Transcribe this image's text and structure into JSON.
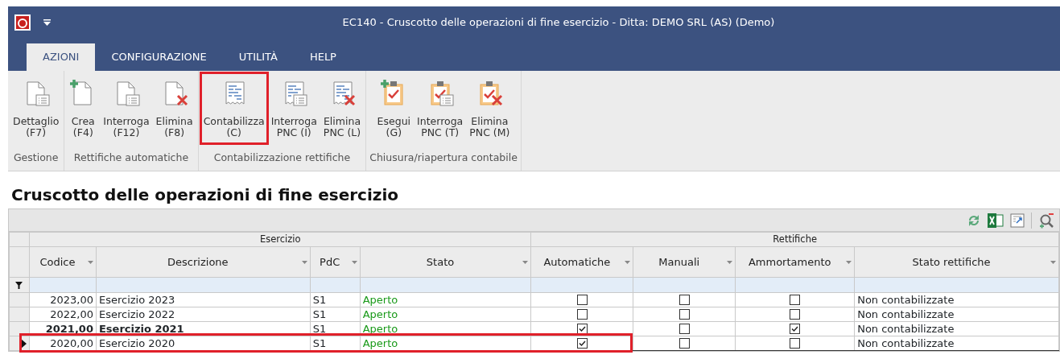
{
  "window": {
    "title": "EC140 - Cruscotto delle operazioni di fine esercizio - Ditta: DEMO SRL (AS)  (Demo)"
  },
  "tabs": [
    {
      "label": "AZIONI",
      "selected": true
    },
    {
      "label": "CONFIGURAZIONE",
      "selected": false
    },
    {
      "label": "UTILITÀ",
      "selected": false
    },
    {
      "label": "HELP",
      "selected": false
    }
  ],
  "ribbon_groups": [
    {
      "label": "Gestione",
      "buttons": [
        {
          "label": "Dettaglio",
          "key": "(F7)",
          "kind": "view",
          "highlighted": false
        }
      ]
    },
    {
      "label": "Rettifiche automatiche",
      "buttons": [
        {
          "label": "Crea",
          "key": "(F4)",
          "kind": "create",
          "highlighted": false
        },
        {
          "label": "Interroga",
          "key": "(F12)",
          "kind": "view",
          "highlighted": false
        },
        {
          "label": "Elimina",
          "key": "(F8)",
          "kind": "delete",
          "highlighted": false
        }
      ]
    },
    {
      "label": "Contabilizzazione rettifiche",
      "buttons": [
        {
          "label": "Contabilizza",
          "key": "(C)",
          "kind": "plain",
          "highlighted": true
        },
        {
          "label": "Interroga",
          "key": "PNC (I)",
          "kind": "view",
          "highlighted": false
        },
        {
          "label": "Elimina",
          "key": "PNC (L)",
          "kind": "delete",
          "highlighted": false
        }
      ]
    },
    {
      "label": "Chiusura/riapertura contabile",
      "buttons": [
        {
          "label": "Esegui",
          "key": "(G)",
          "kind": "create",
          "highlighted": false
        },
        {
          "label": "Interroga",
          "key": "PNC (T)",
          "kind": "view",
          "highlighted": false
        },
        {
          "label": "Elimina",
          "key": "PNC (M)",
          "kind": "delete",
          "highlighted": false
        }
      ]
    }
  ],
  "page_title": "Cruscotto delle operazioni di fine esercizio",
  "table": {
    "column_groups": [
      {
        "label": "Esercizio",
        "columns": [
          {
            "label": "Codice",
            "kind": "number"
          },
          {
            "label": "Descrizione",
            "kind": "text"
          },
          {
            "label": "PdC",
            "kind": "text"
          },
          {
            "label": "Stato",
            "kind": "status"
          }
        ]
      },
      {
        "label": "Rettifiche",
        "columns": [
          {
            "label": "Automatiche",
            "kind": "check"
          },
          {
            "label": "Manuali",
            "kind": "check"
          },
          {
            "label": "Ammortamento",
            "kind": "check"
          },
          {
            "label": "Stato rettifiche",
            "kind": "text"
          }
        ]
      }
    ],
    "rows": [
      {
        "selected": false,
        "bold": false,
        "highlighted": false,
        "cells": [
          "2023,00",
          "Esercizio 2023",
          "S1",
          "Aperto",
          false,
          false,
          false,
          "Non contabilizzate"
        ]
      },
      {
        "selected": false,
        "bold": false,
        "highlighted": false,
        "cells": [
          "2022,00",
          "Esercizio 2022",
          "S1",
          "Aperto",
          false,
          false,
          false,
          "Non contabilizzate"
        ]
      },
      {
        "selected": false,
        "bold": true,
        "highlighted": false,
        "cells": [
          "2021,00",
          "Esercizio 2021",
          "S1",
          "Aperto",
          true,
          false,
          true,
          "Non contabilizzate"
        ]
      },
      {
        "selected": true,
        "bold": false,
        "highlighted": true,
        "cells": [
          "2020,00",
          "Esercizio 2020",
          "S1",
          "Aperto",
          true,
          false,
          false,
          "Non contabilizzate"
        ]
      }
    ]
  }
}
